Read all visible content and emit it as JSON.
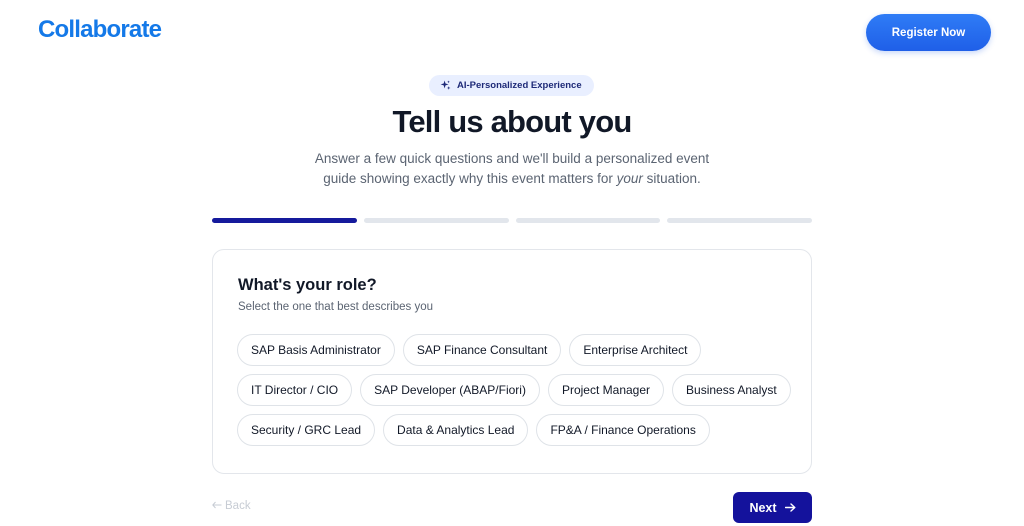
{
  "header": {
    "logo_text": "Collaborate",
    "register_label": "Register Now"
  },
  "badge": {
    "icon": "sparkles-icon",
    "label": "AI-Personalized Experience"
  },
  "intro": {
    "title": "Tell us about you",
    "subtitle_line1": "Answer a few quick questions and we'll build a personalized event",
    "subtitle_line2_pre": "guide showing exactly why this event matters for ",
    "subtitle_line2_em": "your",
    "subtitle_line2_post": " situation."
  },
  "progress": {
    "total_steps": 4,
    "current_step": 1
  },
  "question": {
    "title": "What's your role?",
    "helper": "Select the one that best describes you",
    "rows": [
      [
        "SAP Basis Administrator",
        "SAP Finance Consultant",
        "Enterprise Architect"
      ],
      [
        "IT Director / CIO",
        "SAP Developer (ABAP/Fiori)",
        "Project Manager",
        "Business Analyst"
      ],
      [
        "Security / GRC Lead",
        "Data & Analytics Lead",
        "FP&A / Finance Operations"
      ]
    ]
  },
  "nav": {
    "back_label": "Back",
    "back_icon": "arrow-left-icon",
    "next_label": "Next",
    "next_icon": "arrow-right-icon"
  },
  "colors": {
    "brand": "#1479e8",
    "register_button": "#2a6df4",
    "progress_active": "#151a9c",
    "next_button": "#14129c"
  }
}
